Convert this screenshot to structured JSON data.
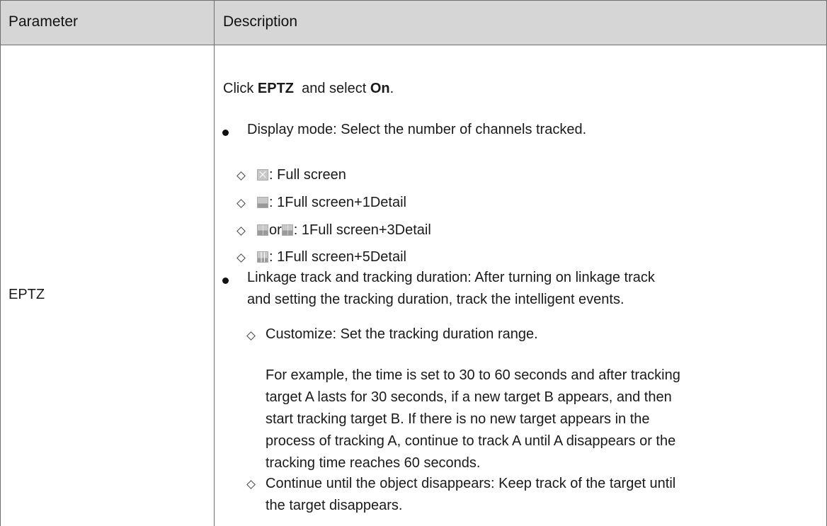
{
  "table": {
    "headers": {
      "parameter": "Parameter",
      "description": "Description"
    },
    "row": {
      "parameter": "EPTZ",
      "intro": {
        "prefix": "Click ",
        "bold1": "EPTZ",
        "middle": "  and select ",
        "bold2": "On",
        "suffix": "."
      },
      "display_mode": {
        "text": "Display mode: Select the number of channels tracked.",
        "options": [
          {
            "icon": "full-screen-icon",
            "label": ": Full screen"
          },
          {
            "icon": "one-plus-one-icon",
            "label": ": 1Full screen+1Detail"
          },
          {
            "icon": "one-plus-three-icon",
            "alt_icon": "one-plus-three-alt-icon",
            "connector": "or",
            "label": ": 1Full screen+3Detail"
          },
          {
            "icon": "one-plus-five-icon",
            "label": ": 1Full screen+5Detail"
          }
        ]
      },
      "linkage": {
        "line1": "Linkage track and tracking duration: After turning on linkage track",
        "line2": "and setting the tracking duration, track the intelligent events.",
        "customize": {
          "text": "Customize: Set the tracking duration range.",
          "example_lines": [
            "For example, the time is set to 30 to 60 seconds and after tracking",
            "target A lasts for 30 seconds, if a new target B appears, and then",
            "start tracking target B. If there is no new target appears in the",
            "process of tracking A, continue to track A until A disappears or the",
            "tracking time reaches 60 seconds."
          ]
        },
        "continue": {
          "line1": "Continue until the object disappears: Keep track of the target until",
          "line2": "the target disappears."
        }
      }
    }
  }
}
